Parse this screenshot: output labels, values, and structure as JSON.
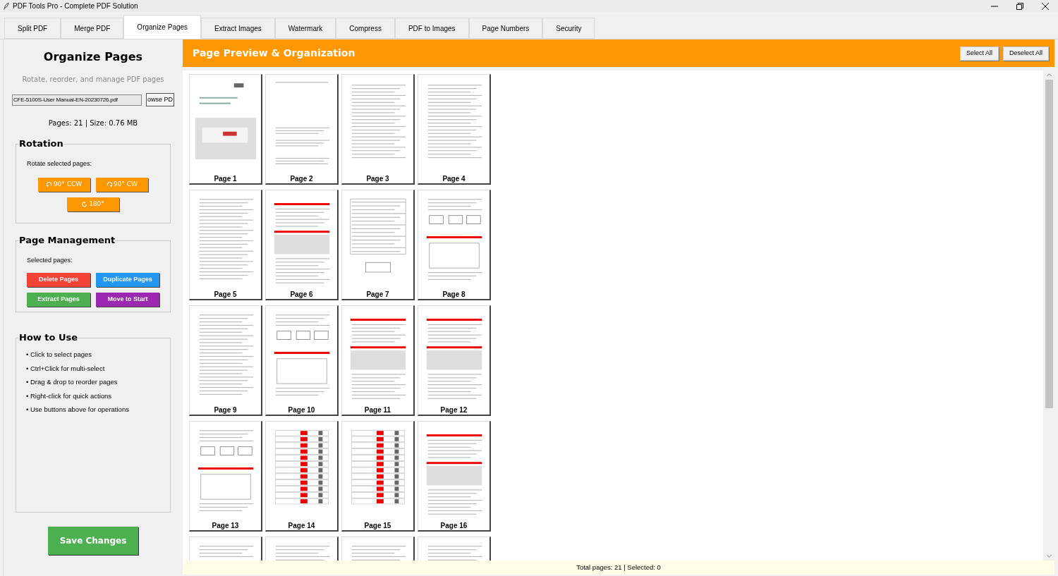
{
  "window": {
    "title": "PDF Tools Pro - Complete PDF Solution"
  },
  "tabs": [
    {
      "label": "Split PDF",
      "selected": false
    },
    {
      "label": "Merge PDF",
      "selected": false
    },
    {
      "label": "Organize Pages",
      "selected": true
    },
    {
      "label": "Extract Images",
      "selected": false
    },
    {
      "label": "Watermark",
      "selected": false
    },
    {
      "label": "Compress",
      "selected": false
    },
    {
      "label": "PDF to Images",
      "selected": false
    },
    {
      "label": "Page Numbers",
      "selected": false
    },
    {
      "label": "Security",
      "selected": false
    }
  ],
  "sidebar": {
    "title": "Organize Pages",
    "subtitle": "Rotate, reorder, and manage PDF pages",
    "file_field": {
      "value": "CFE-5100S-User Manual-EN-20230726.pdf"
    },
    "browse_button": "owse PD",
    "file_info": "Pages: 21 | Size: 0.76 MB",
    "rotation": {
      "title": "Rotation",
      "label": "Rotate selected pages:",
      "buttons": [
        {
          "label": "90° CCW",
          "kind": "ccw"
        },
        {
          "label": "90° CW",
          "kind": "cw"
        },
        {
          "label": "180°",
          "kind": "flip"
        }
      ]
    },
    "page_management": {
      "title": "Page Management",
      "label": "Selected pages:",
      "buttons": [
        {
          "label": "Delete Pages",
          "color": "#f44336"
        },
        {
          "label": "Duplicate Pages",
          "color": "#2196f3"
        },
        {
          "label": "Extract Pages",
          "color": "#4caf50"
        },
        {
          "label": "Move to Start",
          "color": "#9c27b0"
        }
      ]
    },
    "how_to_use": {
      "title": "How to Use",
      "items": [
        "• Click to select pages",
        "• Ctrl+Click for multi-select",
        "• Drag & drop to reorder pages",
        "• Right-click for quick actions",
        "• Use buttons above for operations"
      ]
    },
    "save_button": "Save Changes"
  },
  "preview": {
    "title": "Page Preview & Organization",
    "buttons": [
      "Select All",
      "Deselect All"
    ],
    "pages": [
      {
        "label": "Page 1",
        "kind": "cover",
        "selected": false
      },
      {
        "label": "Page 2",
        "kind": "sparse",
        "selected": false
      },
      {
        "label": "Page 3",
        "kind": "toc",
        "selected": false
      },
      {
        "label": "Page 4",
        "kind": "toc",
        "selected": false
      },
      {
        "label": "Page 5",
        "kind": "text",
        "selected": false
      },
      {
        "label": "Page 6",
        "kind": "redtable",
        "selected": false
      },
      {
        "label": "Page 7",
        "kind": "table",
        "selected": false
      },
      {
        "label": "Page 8",
        "kind": "diagram",
        "selected": false
      },
      {
        "label": "Page 9",
        "kind": "text",
        "selected": false
      },
      {
        "label": "Page 10",
        "kind": "diagram",
        "selected": false
      },
      {
        "label": "Page 11",
        "kind": "redtable",
        "selected": false
      },
      {
        "label": "Page 12",
        "kind": "redtable",
        "selected": false
      },
      {
        "label": "Page 13",
        "kind": "diagram",
        "selected": false
      },
      {
        "label": "Page 14",
        "kind": "redcolumn",
        "selected": false
      },
      {
        "label": "Page 15",
        "kind": "redcolumn",
        "selected": false
      },
      {
        "label": "Page 16",
        "kind": "redtable",
        "selected": false
      },
      {
        "kind": "diagram",
        "selected": false
      },
      {
        "kind": "text",
        "selected": false
      },
      {
        "kind": "text",
        "selected": false
      },
      {
        "kind": "text",
        "selected": false
      }
    ]
  },
  "status_bar": "Total pages: 21 | Selected: 0"
}
